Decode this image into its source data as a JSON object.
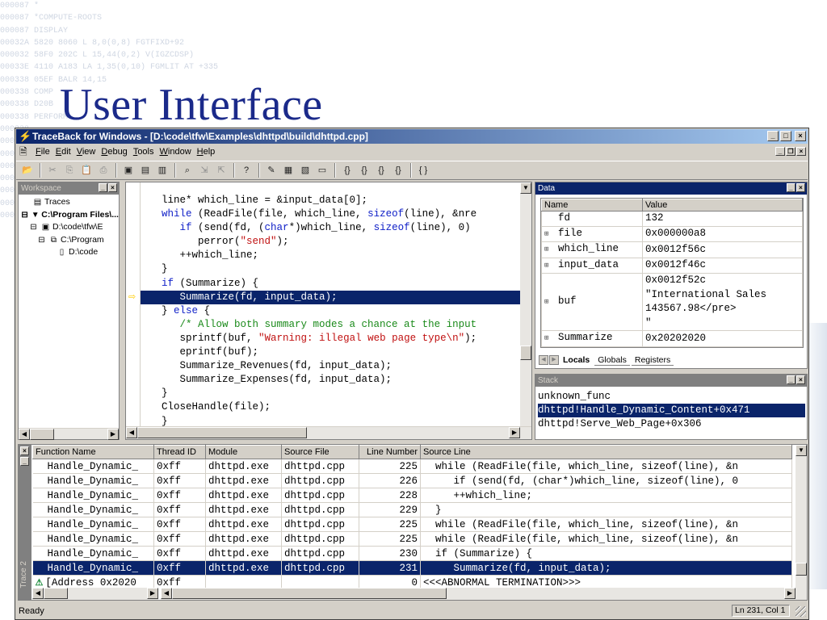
{
  "slide": {
    "title": "User Interface",
    "bg_code_lines": [
      "000087 *",
      "000087 *COMPUTE-ROOTS",
      "000087 DISPLAY",
      "00032A 5820 8060 L 8,0(0,8) FGTFIXD+92",
      "000032 58F0 202C L 15,44(0,2) V(IGZCDSP)",
      "00033E 4110 A183 LA 1,35(0,10) FGMLIT AT +335",
      "000338 05EF BALR 14,15",
      "000338 COMP",
      "000338 D20B",
      "000338 PERFORM",
      "000338",
      "000338",
      "000338",
      "000338",
      "000338",
      "000338",
      "000338",
      "000338"
    ]
  },
  "window": {
    "title": "TraceBack for Windows - [D:\\code\\tfw\\Examples\\dhttpd\\build\\dhttpd.cpp]",
    "app_icon": "traceback-lightning-icon",
    "buttons": [
      "_",
      "□",
      "×"
    ]
  },
  "menu": {
    "items": [
      {
        "label": "File",
        "u": "F",
        "rest": "ile"
      },
      {
        "label": "Edit",
        "u": "E",
        "rest": "dit"
      },
      {
        "label": "View",
        "u": "V",
        "rest": "iew"
      },
      {
        "label": "Debug",
        "u": "D",
        "rest": "ebug"
      },
      {
        "label": "Tools",
        "u": "T",
        "rest": "ools"
      },
      {
        "label": "Window",
        "u": "W",
        "rest": "indow"
      },
      {
        "label": "Help",
        "u": "H",
        "rest": "elp"
      }
    ],
    "mdi_buttons": [
      "_",
      "❐",
      "×"
    ]
  },
  "toolbar": {
    "groups": [
      [
        "open-folder-icon"
      ],
      [
        "cut-icon",
        "copy-icon",
        "paste-icon",
        "print-icon"
      ],
      [
        "workspace-toggle-icon",
        "trace-view-icon",
        "stack-view-icon"
      ],
      [
        "find-icon",
        "find-next-icon",
        "find-prev-icon"
      ],
      [
        "help-icon"
      ],
      [
        "edit-icon",
        "data-view-icon",
        "memory-view-icon",
        "window-icon"
      ],
      [
        "step-into-icon",
        "step-over-icon",
        "step-out-icon",
        "run-to-cursor-icon"
      ],
      [
        "brace-match-icon"
      ]
    ],
    "glyphs": {
      "open-folder-icon": "📂",
      "cut-icon": "✂",
      "copy-icon": "⎘",
      "paste-icon": "📋",
      "print-icon": "⎙",
      "workspace-toggle-icon": "▣",
      "trace-view-icon": "▤",
      "stack-view-icon": "▥",
      "find-icon": "⌕",
      "find-next-icon": "⇲",
      "find-prev-icon": "⇱",
      "help-icon": "?",
      "edit-icon": "✎",
      "data-view-icon": "▦",
      "memory-view-icon": "▧",
      "window-icon": "▭",
      "step-into-icon": "{}",
      "step-over-icon": "{}",
      "step-out-icon": "{}",
      "run-to-cursor-icon": "{}",
      "brace-match-icon": "{ }"
    }
  },
  "workspace": {
    "caption": "Workspace",
    "tree": [
      {
        "label": "Traces",
        "icon": "traces-icon",
        "glyph": "▤",
        "expander": "",
        "indent": 0,
        "bold": false
      },
      {
        "label": "C:\\Program Files\\...",
        "icon": "process-icon",
        "glyph": "▼",
        "expander": "⊟",
        "indent": 0,
        "bold": true
      },
      {
        "label": "D:\\code\\tfw\\E",
        "icon": "module-icon",
        "glyph": "▣",
        "expander": "⊟",
        "indent": 1,
        "bold": false
      },
      {
        "label": "C:\\Program",
        "icon": "thread-icon",
        "glyph": "⧉",
        "expander": "⊟",
        "indent": 2,
        "bold": false
      },
      {
        "label": "D:\\code",
        "icon": "file-icon",
        "glyph": "▯",
        "expander": "",
        "indent": 3,
        "bold": false
      }
    ]
  },
  "editor": {
    "lines": [
      {
        "indent": "",
        "parts": [
          [
            "line* which_line = &input_data[0];",
            ""
          ]
        ]
      },
      {
        "indent": "",
        "parts": [
          [
            "while",
            "kw"
          ],
          [
            " (ReadFile(file, which_line, ",
            ""
          ],
          [
            "sizeof",
            "kw"
          ],
          [
            "(line), &nre",
            ""
          ]
        ]
      },
      {
        "indent": "   ",
        "parts": [
          [
            "if",
            "kw"
          ],
          [
            " (send(fd, (",
            ""
          ],
          [
            "char",
            "kw"
          ],
          [
            "*)which_line, ",
            ""
          ],
          [
            "sizeof",
            "kw"
          ],
          [
            "(line), 0)",
            ""
          ]
        ]
      },
      {
        "indent": "      ",
        "parts": [
          [
            "perror(",
            ""
          ],
          [
            "\"send\"",
            "str"
          ],
          [
            ");",
            ""
          ]
        ]
      },
      {
        "indent": "   ",
        "parts": [
          [
            "++which_line;",
            ""
          ]
        ]
      },
      {
        "indent": "",
        "parts": [
          [
            "}",
            ""
          ]
        ]
      },
      {
        "indent": "",
        "parts": [
          [
            "if",
            "kw"
          ],
          [
            " (Summarize) {",
            ""
          ]
        ]
      },
      {
        "indent": "   ",
        "parts": [
          [
            "Summarize(fd, input_data);",
            ""
          ]
        ],
        "highlight": true
      },
      {
        "indent": "",
        "parts": [
          [
            "} ",
            ""
          ],
          [
            "else",
            "kw"
          ],
          [
            " {",
            ""
          ]
        ]
      },
      {
        "indent": "   ",
        "parts": [
          [
            "/* Allow both summary modes a chance at the input",
            "cm"
          ]
        ]
      },
      {
        "indent": "   ",
        "parts": [
          [
            "sprintf(buf, ",
            ""
          ],
          [
            "\"Warning: illegal web page type\\n\"",
            "str"
          ],
          [
            ");",
            ""
          ]
        ]
      },
      {
        "indent": "   ",
        "parts": [
          [
            "eprintf(buf);",
            ""
          ]
        ]
      },
      {
        "indent": "   ",
        "parts": [
          [
            "Summarize_Revenues(fd, input_data);",
            ""
          ]
        ]
      },
      {
        "indent": "   ",
        "parts": [
          [
            "Summarize_Expenses(fd, input_data);",
            ""
          ]
        ]
      },
      {
        "indent": "",
        "parts": [
          [
            "}",
            ""
          ]
        ]
      },
      {
        "indent": "",
        "parts": [
          [
            "CloseHandle(file);",
            ""
          ]
        ]
      },
      {
        "indent": "",
        "parts": [
          [
            "}",
            ""
          ]
        ]
      }
    ]
  },
  "data": {
    "caption": "Data",
    "columns": [
      "Name",
      "Value"
    ],
    "rows": [
      {
        "name": "fd",
        "expandable": false,
        "value": "132"
      },
      {
        "name": "file",
        "expandable": true,
        "value": "0x000000a8"
      },
      {
        "name": "which_line",
        "expandable": true,
        "value": "0x0012f56c"
      },
      {
        "name": "input_data",
        "expandable": true,
        "value": "0x0012f46c"
      },
      {
        "name": "buf",
        "expandable": true,
        "value": "0x0012f52c\n\"International Sales\n143567.98</pre>\n\""
      },
      {
        "name": "Summarize",
        "expandable": true,
        "value": "0x20202020"
      }
    ],
    "tabs": [
      "Locals",
      "Globals",
      "Registers"
    ],
    "active_tab": "Locals"
  },
  "stack": {
    "caption": "Stack",
    "frames": [
      "unknown_func",
      "dhttpd!Handle_Dynamic_Content+0x471",
      "dhttpd!Serve_Web_Page+0x306"
    ],
    "selected_index": 1
  },
  "trace": {
    "side_label": "Trace 2",
    "columns": [
      {
        "label": "Function Name",
        "width": 150,
        "num": false
      },
      {
        "label": "Thread ID",
        "width": 64,
        "num": false
      },
      {
        "label": "Module",
        "width": 94,
        "num": false
      },
      {
        "label": "Source File",
        "width": 96,
        "num": false
      },
      {
        "label": "Line Number",
        "width": 76,
        "num": true
      },
      {
        "label": "Source Line",
        "width": 460,
        "num": false
      }
    ],
    "rows": [
      {
        "fn": "  Handle_Dynamic_",
        "tid": "0xff",
        "mod": "dhttpd.exe",
        "file": "dhttpd.cpp",
        "line": "225",
        "src": "  while (ReadFile(file, which_line, sizeof(line), &n"
      },
      {
        "fn": "  Handle_Dynamic_",
        "tid": "0xff",
        "mod": "dhttpd.exe",
        "file": "dhttpd.cpp",
        "line": "226",
        "src": "     if (send(fd, (char*)which_line, sizeof(line), 0"
      },
      {
        "fn": "  Handle_Dynamic_",
        "tid": "0xff",
        "mod": "dhttpd.exe",
        "file": "dhttpd.cpp",
        "line": "228",
        "src": "     ++which_line;"
      },
      {
        "fn": "  Handle_Dynamic_",
        "tid": "0xff",
        "mod": "dhttpd.exe",
        "file": "dhttpd.cpp",
        "line": "229",
        "src": "  }"
      },
      {
        "fn": "  Handle_Dynamic_",
        "tid": "0xff",
        "mod": "dhttpd.exe",
        "file": "dhttpd.cpp",
        "line": "225",
        "src": "  while (ReadFile(file, which_line, sizeof(line), &n"
      },
      {
        "fn": "  Handle_Dynamic_",
        "tid": "0xff",
        "mod": "dhttpd.exe",
        "file": "dhttpd.cpp",
        "line": "225",
        "src": "  while (ReadFile(file, which_line, sizeof(line), &n"
      },
      {
        "fn": "  Handle_Dynamic_",
        "tid": "0xff",
        "mod": "dhttpd.exe",
        "file": "dhttpd.cpp",
        "line": "230",
        "src": "  if (Summarize) {"
      },
      {
        "fn": "  Handle_Dynamic_",
        "tid": "0xff",
        "mod": "dhttpd.exe",
        "file": "dhttpd.cpp",
        "line": "231",
        "src": "     Summarize(fd, input_data);",
        "highlight": true
      },
      {
        "fn": "[Address 0x2020",
        "tid": "0xff",
        "mod": "",
        "file": "",
        "line": "0",
        "src": "<<<ABNORMAL TERMINATION>>>",
        "warning": true
      }
    ]
  },
  "status": {
    "text": "Ready",
    "position": "Ln 231, Col 1"
  },
  "colors": {
    "title_blue": "#1b2a8a",
    "selection": "#0a246a",
    "keyword": "#1020c8",
    "string": "#c01010",
    "comment": "#1a8a1a"
  }
}
